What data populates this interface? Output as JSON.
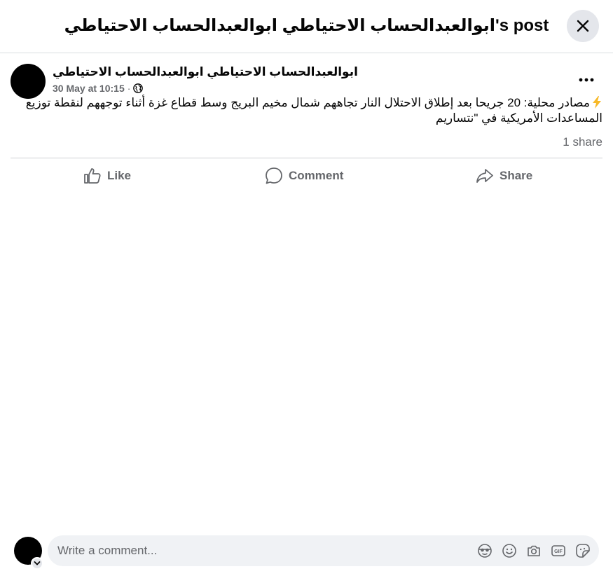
{
  "header": {
    "title": "ابوالعبدالحساب الاحتياطي ابوالعبدالحساب الاحتياطي's post"
  },
  "post": {
    "author": "ابوالعبدالحساب الاحتياطي ابوالعبدالحساب الاحتياطي",
    "timestamp": "30 May at 10:15",
    "audience_icon": "globe-icon",
    "text": "مصادر محلية: 20 جريحا بعد إطلاق الاحتلال النار تجاههم شمال مخيم البريج وسط قطاع غزة أثناء توجههم لنقطة توزيع المساعدات الأمريكية في \"نتساريم",
    "shares": "1 share"
  },
  "actions": {
    "like": "Like",
    "comment": "Comment",
    "share": "Share"
  },
  "composer": {
    "placeholder": "Write a comment...",
    "tools": [
      "avatar-sticker-icon",
      "emoji-icon",
      "camera-icon",
      "gif-icon",
      "sticker-icon"
    ]
  },
  "colors": {
    "secondary_text": "#65676b",
    "input_bg": "#f0f2f5",
    "button_bg": "#e4e6eb",
    "bolt": "#f7b928"
  }
}
